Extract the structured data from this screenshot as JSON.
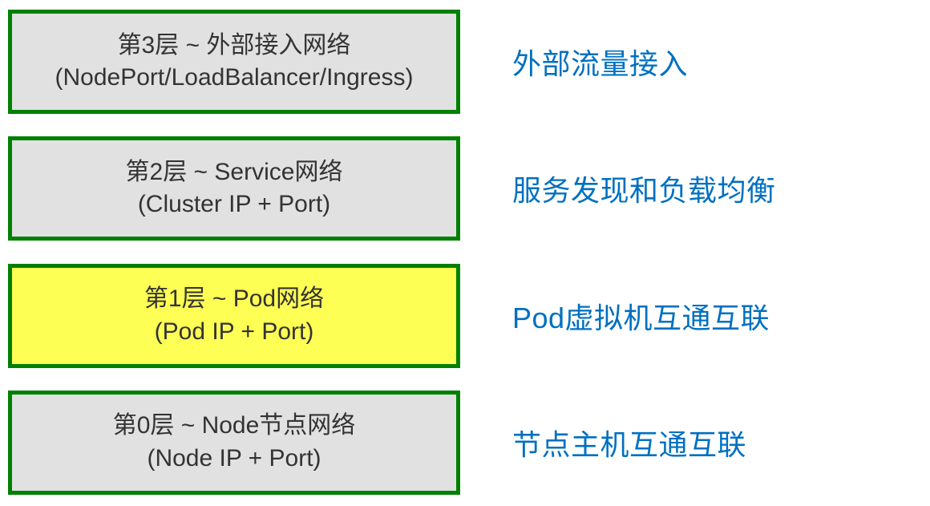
{
  "colors": {
    "border": "#008000",
    "box_default_bg": "#e1e1e1",
    "box_highlight_bg": "#feff54",
    "box_text": "#333333",
    "desc_text": "#0070c0"
  },
  "layers": [
    {
      "id": "layer3",
      "title": "第3层  ~  外部接入网络",
      "detail": "(NodePort/LoadBalancer/Ingress)",
      "desc": "外部流量接入",
      "highlight": false
    },
    {
      "id": "layer2",
      "title": "第2层  ~  Service网络",
      "detail": "(Cluster IP + Port)",
      "desc": "服务发现和负载均衡",
      "highlight": false
    },
    {
      "id": "layer1",
      "title": "第1层  ~  Pod网络",
      "detail": "(Pod IP + Port)",
      "desc": "Pod虚拟机互通互联",
      "highlight": true
    },
    {
      "id": "layer0",
      "title": "第0层  ~  Node节点网络",
      "detail": "(Node IP + Port)",
      "desc": "节点主机互通互联",
      "highlight": false
    }
  ]
}
